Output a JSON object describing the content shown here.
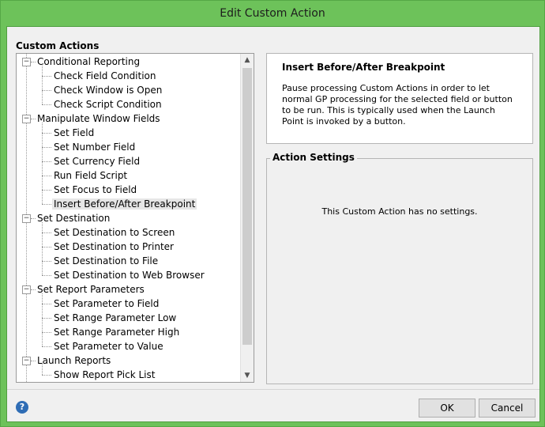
{
  "window": {
    "title": "Edit Custom Action"
  },
  "custom_actions": {
    "label": "Custom Actions",
    "tree": [
      {
        "label": "Conditional Reporting",
        "expander": "−",
        "children": [
          "Check Field Condition",
          "Check Window is Open",
          "Check Script Condition"
        ]
      },
      {
        "label": "Manipulate Window Fields",
        "expander": "−",
        "children": [
          "Set Field",
          "Set Number Field",
          "Set Currency Field",
          "Run Field Script",
          "Set Focus to Field",
          "Insert Before/After Breakpoint"
        ]
      },
      {
        "label": "Set Destination",
        "expander": "−",
        "children": [
          "Set Destination to Screen",
          "Set Destination to Printer",
          "Set Destination to File",
          "Set Destination to Web Browser"
        ]
      },
      {
        "label": "Set Report Parameters",
        "expander": "−",
        "children": [
          "Set Parameter to Field",
          "Set Range Parameter Low",
          "Set Range Parameter High",
          "Set Parameter to Value"
        ]
      },
      {
        "label": "Launch Reports",
        "expander": "−",
        "children": [
          "Show Report Pick List"
        ]
      }
    ],
    "selected": "Insert Before/After Breakpoint"
  },
  "description": {
    "title": "Insert Before/After Breakpoint",
    "text": "Pause processing Custom Actions in order to let normal GP processing for the selected field or button to be run.  This is typically used when the Launch Point is invoked by a button."
  },
  "settings": {
    "legend": "Action Settings",
    "message": "This Custom Action has no settings."
  },
  "buttons": {
    "ok": "OK",
    "cancel": "Cancel",
    "help": "?"
  },
  "scrollbar": {
    "up": "▲",
    "down": "▼"
  },
  "colors": {
    "title_bar": "#6dc25a",
    "client": "#f0f0f0",
    "help_icon": "#2f6db5"
  }
}
